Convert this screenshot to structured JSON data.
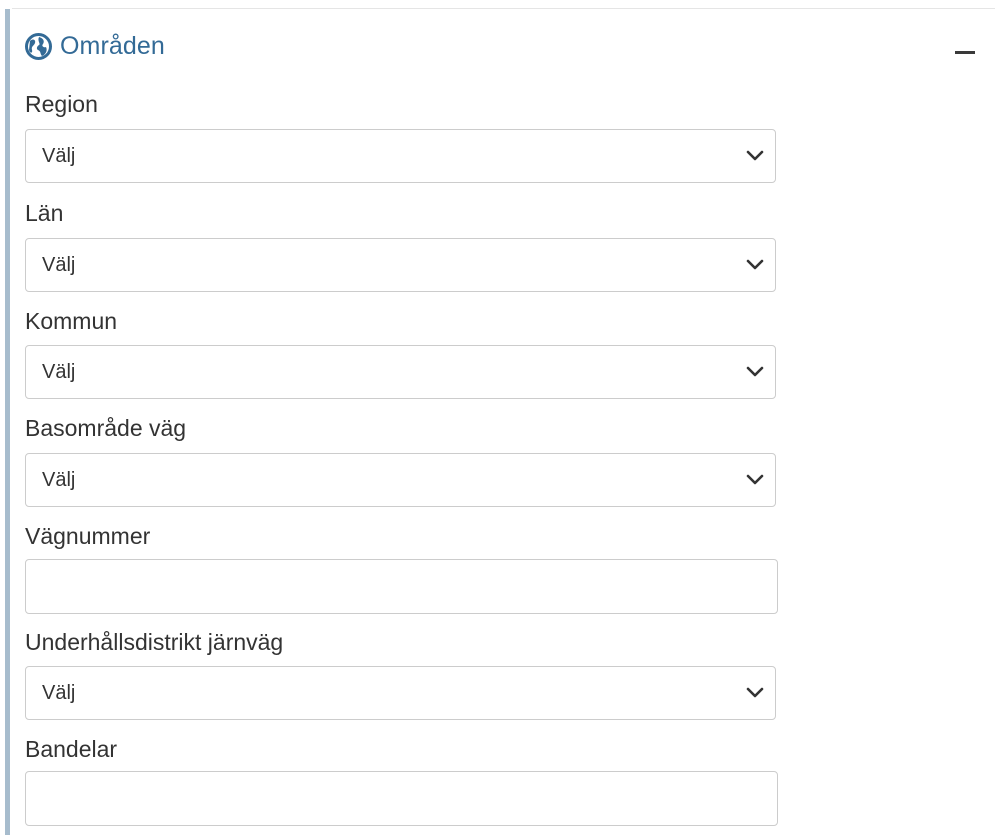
{
  "panel": {
    "title": "Områden",
    "icon": "globe-icon",
    "collapse_icon": "minus-icon",
    "accent_color": "#a7bccd",
    "title_color": "#336a96"
  },
  "fields": {
    "region": {
      "label": "Region",
      "value": "Välj"
    },
    "lan": {
      "label": "Län",
      "value": "Välj"
    },
    "kommun": {
      "label": "Kommun",
      "value": "Välj"
    },
    "basomrade_vag": {
      "label": "Basområde väg",
      "value": "Välj"
    },
    "vagnummer": {
      "label": "Vägnummer",
      "value": ""
    },
    "underhallsdistrikt_jarnvag": {
      "label": "Underhållsdistrikt järnväg",
      "value": "Välj"
    },
    "bandelar": {
      "label": "Bandelar",
      "value": ""
    }
  }
}
